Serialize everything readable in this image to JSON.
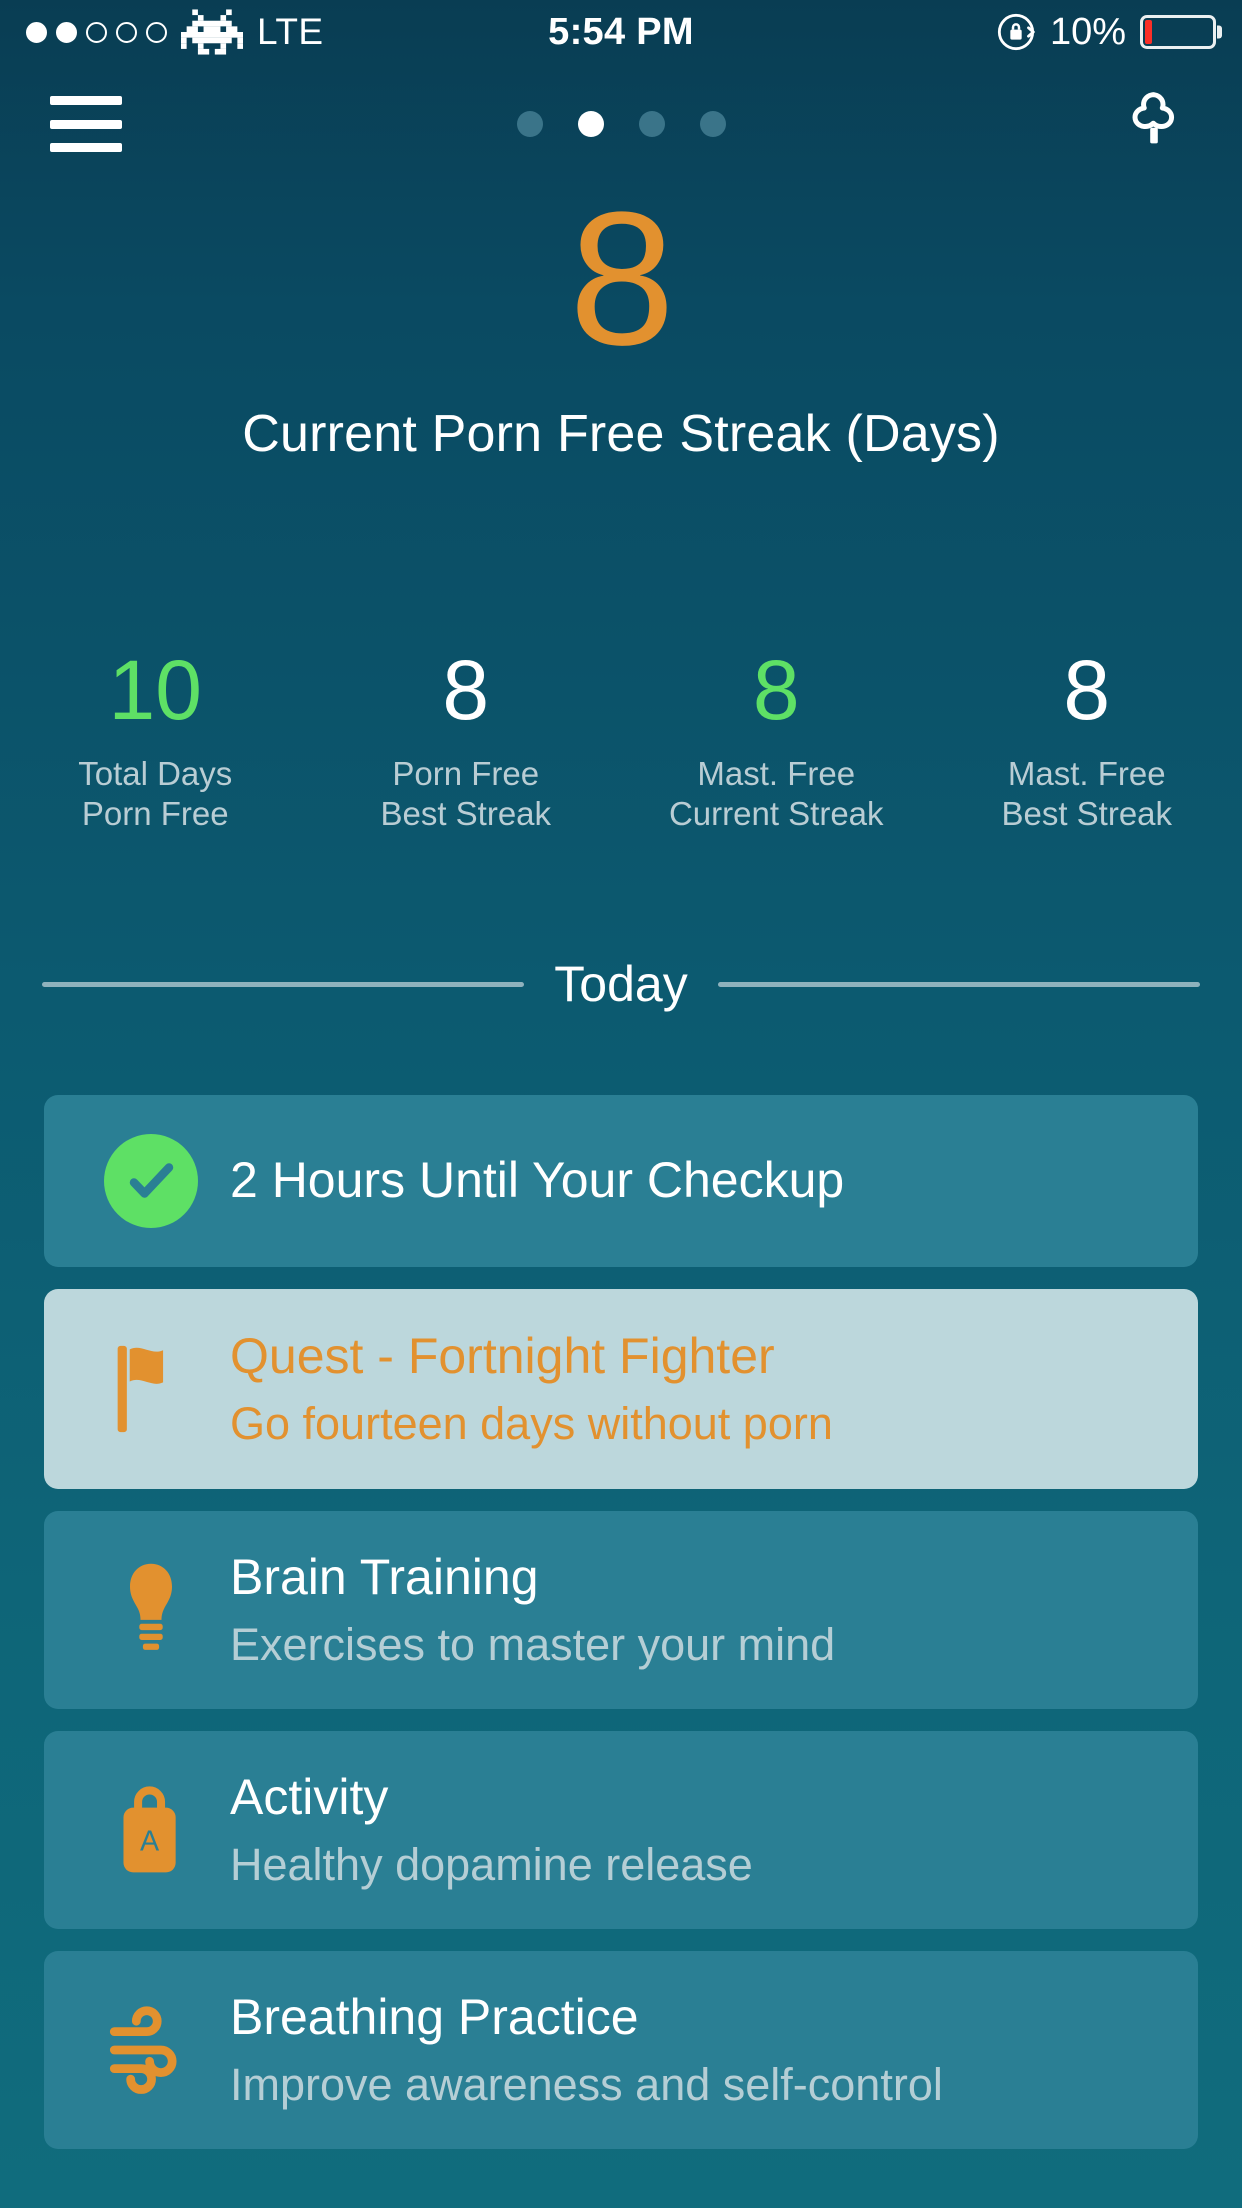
{
  "status_bar": {
    "signal_dots_total": 5,
    "signal_dots_filled": 2,
    "carrier_icon": "space-invader-icon",
    "carrier": "LTE",
    "time": "5:54 PM",
    "rotation_lock_icon": "rotation-lock-icon",
    "battery_percent": "10%",
    "battery_level": 10,
    "battery_color": "#fa2f28"
  },
  "nav": {
    "menu_icon": "hamburger-menu-icon",
    "page_dots_total": 4,
    "page_dots_active_index": 1,
    "right_icon": "tree-icon"
  },
  "hero": {
    "value": "8",
    "label": "Current Porn Free Streak (Days)",
    "value_color": "#e2912f"
  },
  "stats": [
    {
      "value": "10",
      "label": "Total Days\nPorn Free",
      "color": "#5ee065"
    },
    {
      "value": "8",
      "label": "Porn Free\nBest Streak",
      "color": "#ffffff"
    },
    {
      "value": "8",
      "label": "Mast. Free\nCurrent Streak",
      "color": "#5ee065"
    },
    {
      "value": "8",
      "label": "Mast. Free\nBest Streak",
      "color": "#ffffff"
    }
  ],
  "section": {
    "today_label": "Today"
  },
  "cards": [
    {
      "icon": "check-circle-icon",
      "title": "2 Hours Until Your Checkup",
      "subtitle": "",
      "highlighted": false
    },
    {
      "icon": "flag-icon",
      "title": "Quest - Fortnight Fighter",
      "subtitle": "Go fourteen days without porn",
      "highlighted": true
    },
    {
      "icon": "lightbulb-icon",
      "title": "Brain Training",
      "subtitle": "Exercises to master your mind",
      "highlighted": false
    },
    {
      "icon": "briefcase-icon",
      "title": "Activity",
      "subtitle": "Healthy dopamine release",
      "highlighted": false
    },
    {
      "icon": "wind-icon",
      "title": "Breathing Practice",
      "subtitle": "Improve awareness and self-control",
      "highlighted": false
    }
  ],
  "theme": {
    "background_top": "#093d53",
    "background_bottom": "#106c7d",
    "card_bg": "#2a7f94",
    "card_highlight_bg": "#bcd7dc",
    "accent_orange": "#e2912f",
    "accent_green": "#5ee065"
  }
}
